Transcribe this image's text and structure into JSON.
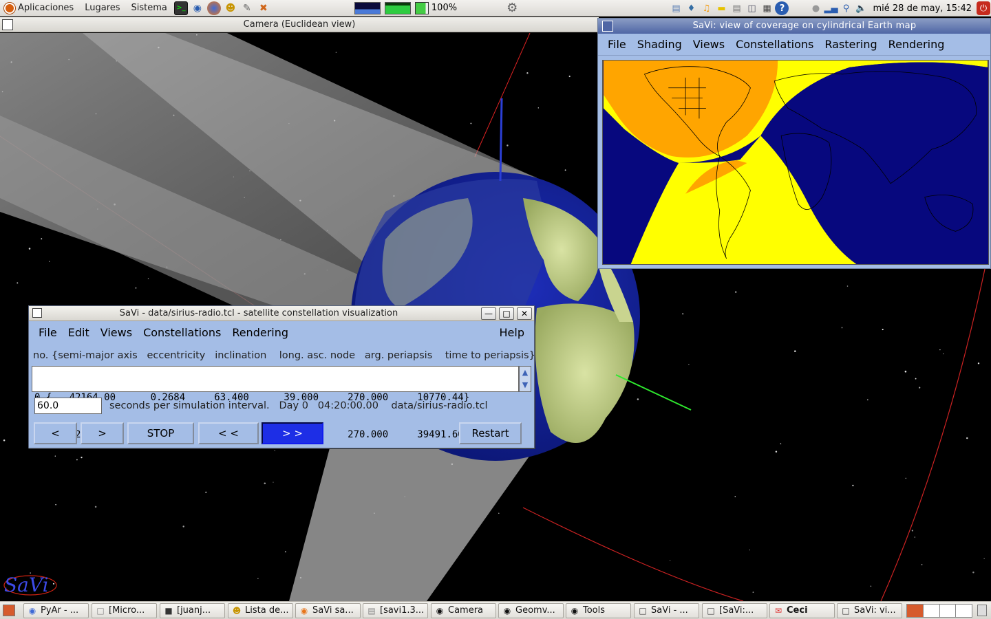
{
  "top_panel": {
    "menus": [
      "Aplicaciones",
      "Lugares",
      "Sistema"
    ],
    "battery_label": "100%",
    "clock": "mié 28 de may, 15:42"
  },
  "camera_window": {
    "title": "Camera (Euclidean view)"
  },
  "savi_logo": "SaVi",
  "map_window": {
    "title": "SaVi: view of coverage on cylindrical Earth map",
    "menu": [
      "File",
      "Shading",
      "Views",
      "Constellations",
      "Rastering",
      "Rendering"
    ],
    "colors": {
      "ocean": "#07087e",
      "coverage_single": "#ffff00",
      "coverage_double": "#ffa500"
    }
  },
  "control_window": {
    "title": "SaVi - data/sirius-radio.tcl - satellite constellation visualization",
    "menu": [
      "File",
      "Edit",
      "Views",
      "Constellations",
      "Rendering"
    ],
    "help": "Help",
    "header": "no. {semi-major axis   eccentricity   inclination    long. asc. node   arg. periapsis    time to periapsis}",
    "satellites": [
      "0 {   42164.00      0.2684     63.400      39.000     270.000     10770.44}",
      "1 {   42164.00      0.2684     63.400     159.000     270.000     39491.60}"
    ],
    "interval_value": "60.0",
    "status": "seconds per simulation interval.   Day 0   04:20:00.00    data/sirius-radio.tcl",
    "buttons": {
      "back": "<",
      "forward": ">",
      "stop": "STOP",
      "fast_back": "< <",
      "fast_forward": "> >",
      "restart": "Restart"
    }
  },
  "taskbar": {
    "tasks": [
      "PyAr - ...",
      "[Micro...",
      "[juanj...",
      "Lista de...",
      "SaVi sa...",
      "[savi1.3...",
      "Camera",
      "Geomv...",
      "Tools",
      "SaVi - ...",
      "[SaVi:...",
      "Ceci",
      "SaVi: vi..."
    ]
  }
}
